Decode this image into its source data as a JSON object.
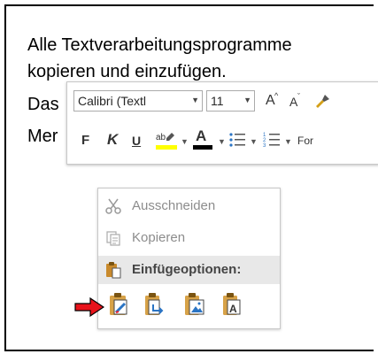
{
  "document": {
    "line1": "Alle Textverarbeitungsprogramme",
    "line2": "kopieren und einzufügen.",
    "line3": "Das",
    "line4": "Mer"
  },
  "mini_toolbar": {
    "font_name": "Calibri (Textl",
    "font_size": "11",
    "grow_font": "A",
    "shrink_font": "A",
    "bold": "F",
    "italic": "K",
    "underline": "U",
    "highlight": "ab",
    "font_color": "A",
    "styles_partial": "For",
    "highlight_color": "#ffff00",
    "font_color_value": "#000000"
  },
  "context_menu": {
    "cut": "Ausschneiden",
    "copy": "Kopieren",
    "paste_options": "Einfügeoptionen:",
    "paste_buttons": [
      {
        "icon": "keep-source-formatting-icon"
      },
      {
        "icon": "merge-formatting-icon"
      },
      {
        "icon": "picture-paste-icon"
      },
      {
        "icon": "keep-text-only-icon"
      }
    ]
  },
  "colors": {
    "arrow": "#e8131b",
    "accent_blue": "#2a74c4",
    "clipboard": "#b07a2a"
  }
}
